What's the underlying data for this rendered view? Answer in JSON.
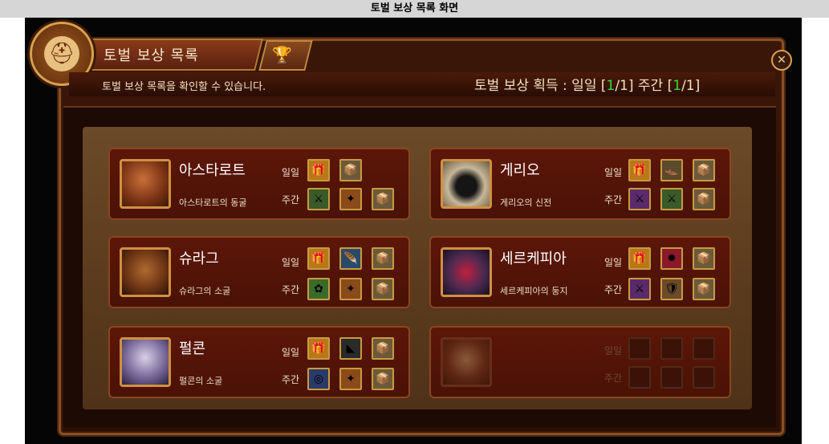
{
  "page_title": "토벌 보상 목록 화면",
  "window": {
    "title": "토벌 보상 목록",
    "subtitle": "토벌 보상 목록을 확인할 수 있습니다.",
    "counter": {
      "prefix": "토벌 보상 획득 : 일일 [",
      "daily_current": "1",
      "daily_sep": "/1] 주간 [",
      "weekly_current": "1",
      "weekly_sep": "/1]"
    },
    "icons": {
      "emblem": "helmet-emblem-icon",
      "trophy": "trophy-icon",
      "close": "close-icon"
    }
  },
  "labels": {
    "daily": "일일",
    "weekly": "주간"
  },
  "bosses": [
    {
      "name": "아스타로트",
      "place": "아스타로트의 동굴"
    },
    {
      "name": "게리오",
      "place": "게리오의 신전"
    },
    {
      "name": "슈라그",
      "place": "슈라그의 소굴"
    },
    {
      "name": "세르케피아",
      "place": "세르케피아의 둥지"
    },
    {
      "name": "펄콘",
      "place": "펄콘의 소굴"
    },
    {
      "name": "",
      "place": ""
    }
  ],
  "colors": {
    "accent_green": "#3cd830",
    "frame_gold": "#c89a40",
    "card_bg": "#5c1608"
  }
}
